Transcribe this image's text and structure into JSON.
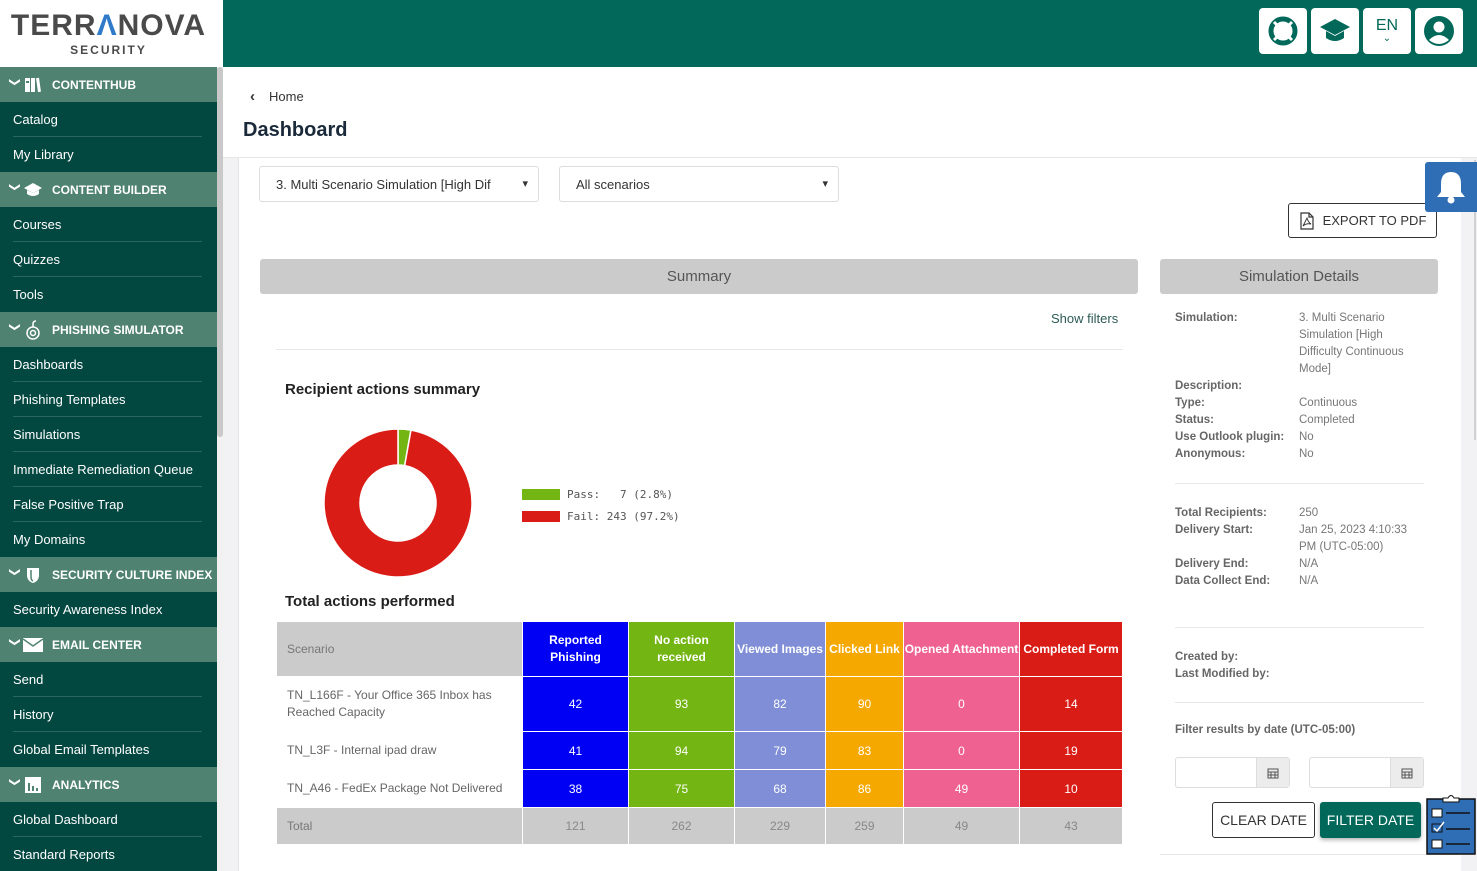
{
  "brand": {
    "name_part1": "TERR",
    "name_accent": "Λ",
    "name_part2": "NOVA",
    "subtitle": "SECURITY"
  },
  "sidebar": {
    "sections": [
      {
        "label": "CONTENTHUB",
        "icon": "books-icon",
        "items": [
          "Catalog",
          "My Library"
        ]
      },
      {
        "label": "CONTENT BUILDER",
        "icon": "graduation-cap-icon",
        "items": [
          "Courses",
          "Quizzes",
          "Tools"
        ]
      },
      {
        "label": "PHISHING SIMULATOR",
        "icon": "at-hook-icon",
        "items": [
          "Dashboards",
          "Phishing Templates",
          "Simulations",
          "Immediate Remediation Queue",
          "False Positive Trap",
          "My Domains"
        ]
      },
      {
        "label": "SECURITY CULTURE INDEX",
        "icon": "shield-icon",
        "items": [
          "Security Awareness Index"
        ]
      },
      {
        "label": "EMAIL CENTER",
        "icon": "envelope-icon",
        "items": [
          "Send",
          "History",
          "Global Email Templates"
        ]
      },
      {
        "label": "ANALYTICS",
        "icon": "bar-chart-icon",
        "items": [
          "Global Dashboard",
          "Standard Reports"
        ]
      }
    ]
  },
  "topbar": {
    "language": "EN"
  },
  "breadcrumb": {
    "back_label": "Home"
  },
  "page_title": "Dashboard",
  "filters": {
    "simulation_select": "3. Multi Scenario Simulation [High Dif",
    "scenario_select": "All scenarios"
  },
  "export_label": "EXPORT TO PDF",
  "summary": {
    "header": "Summary",
    "show_filters": "Show filters",
    "recipient_title": "Recipient actions summary",
    "total_title": "Total actions performed"
  },
  "chart_data": {
    "type": "pie",
    "title": "Recipient actions summary",
    "donut": true,
    "categories": [
      "Pass",
      "Fail"
    ],
    "values": [
      7,
      243
    ],
    "percentages": [
      2.8,
      97.2
    ],
    "colors": [
      "#73b512",
      "#da1c17"
    ],
    "legend": [
      "Pass:   7 (2.8%)",
      "Fail: 243 (97.2%)"
    ],
    "legend_position": "right"
  },
  "table": {
    "headers": [
      {
        "label": "Scenario",
        "color": "#cbcbcb"
      },
      {
        "label": "Reported Phishing",
        "color": "#0000f5"
      },
      {
        "label": "No action received",
        "color": "#73b512"
      },
      {
        "label": "Viewed Images",
        "color": "#7f8ed6"
      },
      {
        "label": "Clicked Link",
        "color": "#f5a800"
      },
      {
        "label": "Opened Attachment",
        "color": "#ef6191"
      },
      {
        "label": "Completed Form",
        "color": "#da1c17"
      }
    ],
    "rows": [
      {
        "scenario": "TN_L166F - Your Office 365 Inbox has Reached Capacity",
        "values": [
          "42",
          "93",
          "82",
          "90",
          "0",
          "14"
        ]
      },
      {
        "scenario": "TN_L3F - Internal ipad draw",
        "values": [
          "41",
          "94",
          "79",
          "83",
          "0",
          "19"
        ]
      },
      {
        "scenario": "TN_A46 - FedEx Package Not Delivered",
        "values": [
          "38",
          "75",
          "68",
          "86",
          "49",
          "10"
        ]
      }
    ],
    "total": {
      "label": "Total",
      "values": [
        "121",
        "262",
        "229",
        "259",
        "49",
        "43"
      ]
    }
  },
  "details": {
    "header": "Simulation Details",
    "group1": [
      {
        "k": "Simulation:",
        "v": "3. Multi Scenario Simulation [High Difficulty Continuous Mode]"
      },
      {
        "k": "Description:",
        "v": ""
      },
      {
        "k": "Type:",
        "v": "Continuous"
      },
      {
        "k": "Status:",
        "v": "Completed"
      },
      {
        "k": "Use Outlook plugin:",
        "v": "No"
      },
      {
        "k": "Anonymous:",
        "v": "No"
      }
    ],
    "group2": [
      {
        "k": "Total Recipients:",
        "v": "250"
      },
      {
        "k": "Delivery Start:",
        "v": "Jan 25, 2023 4:10:33 PM (UTC-05:00)"
      },
      {
        "k": "Delivery End:",
        "v": "N/A"
      },
      {
        "k": "Data Collect End:",
        "v": "N/A"
      }
    ],
    "group3": [
      {
        "k": "Created by:",
        "v": ""
      },
      {
        "k": "Last Modified by:",
        "v": ""
      }
    ],
    "filter_label": "Filter results by date (UTC-05:00)",
    "start_date": "",
    "end_date": "",
    "clear_label": "CLEAR DATE",
    "filter_label_btn": "FILTER DATE"
  }
}
